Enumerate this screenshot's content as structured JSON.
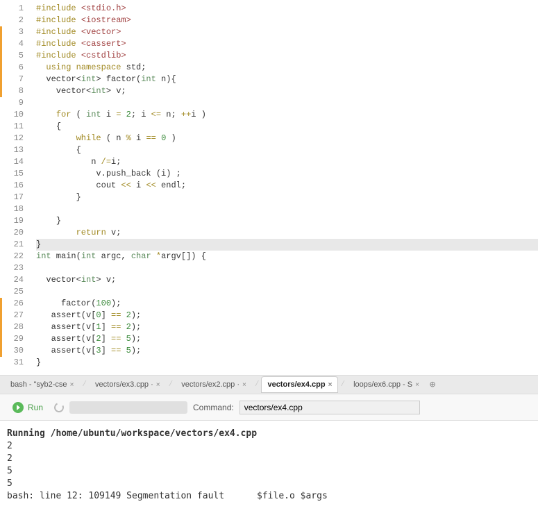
{
  "code_lines": [
    {
      "n": 1,
      "tokens": [
        [
          "macro",
          "#include "
        ],
        [
          "ang",
          "<stdio.h>"
        ]
      ]
    },
    {
      "n": 2,
      "tokens": [
        [
          "macro",
          "#include "
        ],
        [
          "ang",
          "<iostream>"
        ]
      ]
    },
    {
      "n": 3,
      "tokens": [
        [
          "macro",
          "#include "
        ],
        [
          "ang",
          "<vector>"
        ]
      ]
    },
    {
      "n": 4,
      "tokens": [
        [
          "macro",
          "#include "
        ],
        [
          "ang",
          "<cassert>"
        ]
      ]
    },
    {
      "n": 5,
      "tokens": [
        [
          "macro",
          "#include "
        ],
        [
          "ang",
          "<cstdlib>"
        ]
      ]
    },
    {
      "n": 6,
      "tokens": [
        [
          "ident",
          "  "
        ],
        [
          "kw",
          "using"
        ],
        [
          "ident",
          " "
        ],
        [
          "kw",
          "namespace"
        ],
        [
          "ident",
          " std;"
        ]
      ]
    },
    {
      "n": 7,
      "tokens": [
        [
          "ident",
          "  vector<"
        ],
        [
          "type",
          "int"
        ],
        [
          "ident",
          "> factor("
        ],
        [
          "type",
          "int"
        ],
        [
          "ident",
          " n)"
        ],
        [
          "brace",
          "{"
        ]
      ]
    },
    {
      "n": 8,
      "tokens": [
        [
          "ident",
          "    vector<"
        ],
        [
          "type",
          "int"
        ],
        [
          "ident",
          "> v;"
        ]
      ]
    },
    {
      "n": 9,
      "tokens": [
        [
          "ident",
          ""
        ]
      ]
    },
    {
      "n": 10,
      "tokens": [
        [
          "ident",
          "    "
        ],
        [
          "kw",
          "for"
        ],
        [
          "ident",
          " ( "
        ],
        [
          "type",
          "int"
        ],
        [
          "ident",
          " i "
        ],
        [
          "op",
          "="
        ],
        [
          "ident",
          " "
        ],
        [
          "num",
          "2"
        ],
        [
          "ident",
          "; i "
        ],
        [
          "op",
          "<="
        ],
        [
          "ident",
          " n; "
        ],
        [
          "op",
          "++"
        ],
        [
          "ident",
          "i )"
        ]
      ]
    },
    {
      "n": 11,
      "tokens": [
        [
          "ident",
          "    "
        ],
        [
          "brace",
          "{"
        ]
      ]
    },
    {
      "n": 12,
      "tokens": [
        [
          "ident",
          "        "
        ],
        [
          "kw",
          "while"
        ],
        [
          "ident",
          " ( n "
        ],
        [
          "op",
          "%"
        ],
        [
          "ident",
          " i "
        ],
        [
          "op",
          "=="
        ],
        [
          "ident",
          " "
        ],
        [
          "num",
          "0"
        ],
        [
          "ident",
          " )"
        ]
      ]
    },
    {
      "n": 13,
      "tokens": [
        [
          "ident",
          "        "
        ],
        [
          "brace",
          "{"
        ]
      ]
    },
    {
      "n": 14,
      "tokens": [
        [
          "ident",
          "           n "
        ],
        [
          "op",
          "/="
        ],
        [
          "ident",
          "i;"
        ]
      ]
    },
    {
      "n": 15,
      "tokens": [
        [
          "ident",
          "            v.push_back (i) ;"
        ]
      ]
    },
    {
      "n": 16,
      "tokens": [
        [
          "ident",
          "            cout "
        ],
        [
          "op",
          "<<"
        ],
        [
          "ident",
          " i "
        ],
        [
          "op",
          "<<"
        ],
        [
          "ident",
          " endl;"
        ]
      ]
    },
    {
      "n": 17,
      "tokens": [
        [
          "ident",
          "        "
        ],
        [
          "brace",
          "}"
        ]
      ]
    },
    {
      "n": 18,
      "tokens": [
        [
          "ident",
          ""
        ]
      ]
    },
    {
      "n": 19,
      "tokens": [
        [
          "ident",
          "    "
        ],
        [
          "brace",
          "}"
        ]
      ]
    },
    {
      "n": 20,
      "tokens": [
        [
          "ident",
          "        "
        ],
        [
          "kw",
          "return"
        ],
        [
          "ident",
          " v;"
        ]
      ]
    },
    {
      "n": 21,
      "hl": true,
      "tokens": [
        [
          "brace",
          "}"
        ]
      ]
    },
    {
      "n": 22,
      "tokens": [
        [
          "type",
          "int"
        ],
        [
          "ident",
          " main("
        ],
        [
          "type",
          "int"
        ],
        [
          "ident",
          " argc, "
        ],
        [
          "type",
          "char"
        ],
        [
          "ident",
          " "
        ],
        [
          "op",
          "*"
        ],
        [
          "ident",
          "argv[]) "
        ],
        [
          "brace",
          "{"
        ]
      ]
    },
    {
      "n": 23,
      "tokens": [
        [
          "ident",
          ""
        ]
      ]
    },
    {
      "n": 24,
      "tokens": [
        [
          "ident",
          "  vector<"
        ],
        [
          "type",
          "int"
        ],
        [
          "ident",
          "> v;"
        ]
      ]
    },
    {
      "n": 25,
      "tokens": [
        [
          "ident",
          ""
        ]
      ]
    },
    {
      "n": 26,
      "tokens": [
        [
          "ident",
          "     factor("
        ],
        [
          "num",
          "100"
        ],
        [
          "ident",
          ");"
        ]
      ]
    },
    {
      "n": 27,
      "tokens": [
        [
          "ident",
          "   assert(v["
        ],
        [
          "num",
          "0"
        ],
        [
          "ident",
          "] "
        ],
        [
          "op",
          "=="
        ],
        [
          "ident",
          " "
        ],
        [
          "num",
          "2"
        ],
        [
          "ident",
          ");"
        ]
      ]
    },
    {
      "n": 28,
      "tokens": [
        [
          "ident",
          "   assert(v["
        ],
        [
          "num",
          "1"
        ],
        [
          "ident",
          "] "
        ],
        [
          "op",
          "=="
        ],
        [
          "ident",
          " "
        ],
        [
          "num",
          "2"
        ],
        [
          "ident",
          ");"
        ]
      ]
    },
    {
      "n": 29,
      "tokens": [
        [
          "ident",
          "   assert(v["
        ],
        [
          "num",
          "2"
        ],
        [
          "ident",
          "] "
        ],
        [
          "op",
          "=="
        ],
        [
          "ident",
          " "
        ],
        [
          "num",
          "5"
        ],
        [
          "ident",
          ");"
        ]
      ]
    },
    {
      "n": 30,
      "tokens": [
        [
          "ident",
          "   assert(v["
        ],
        [
          "num",
          "3"
        ],
        [
          "ident",
          "] "
        ],
        [
          "op",
          "=="
        ],
        [
          "ident",
          " "
        ],
        [
          "num",
          "5"
        ],
        [
          "ident",
          ");"
        ]
      ]
    },
    {
      "n": 31,
      "tokens": [
        [
          "brace",
          "}"
        ]
      ]
    }
  ],
  "markers": [
    {
      "start": 3,
      "end": 8
    },
    {
      "start": 26,
      "end": 30
    }
  ],
  "tabs": [
    {
      "label": "bash - \"syb2-cse",
      "active": false
    },
    {
      "label": "vectors/ex3.cpp ·",
      "active": false
    },
    {
      "label": "vectors/ex2.cpp ·",
      "active": false
    },
    {
      "label": "vectors/ex4.cpp",
      "active": true
    },
    {
      "label": "loops/ex6.cpp - S",
      "active": false
    }
  ],
  "runbar": {
    "run_label": "Run",
    "command_label": "Command:",
    "command_value": "vectors/ex4.cpp"
  },
  "terminal": [
    {
      "text": "Running /home/ubuntu/workspace/vectors/ex4.cpp",
      "bold": true
    },
    {
      "text": "2"
    },
    {
      "text": "2"
    },
    {
      "text": "5"
    },
    {
      "text": "5"
    },
    {
      "text": ""
    },
    {
      "text": "bash: line 12: 109149 Segmentation fault      $file.o $args"
    }
  ]
}
